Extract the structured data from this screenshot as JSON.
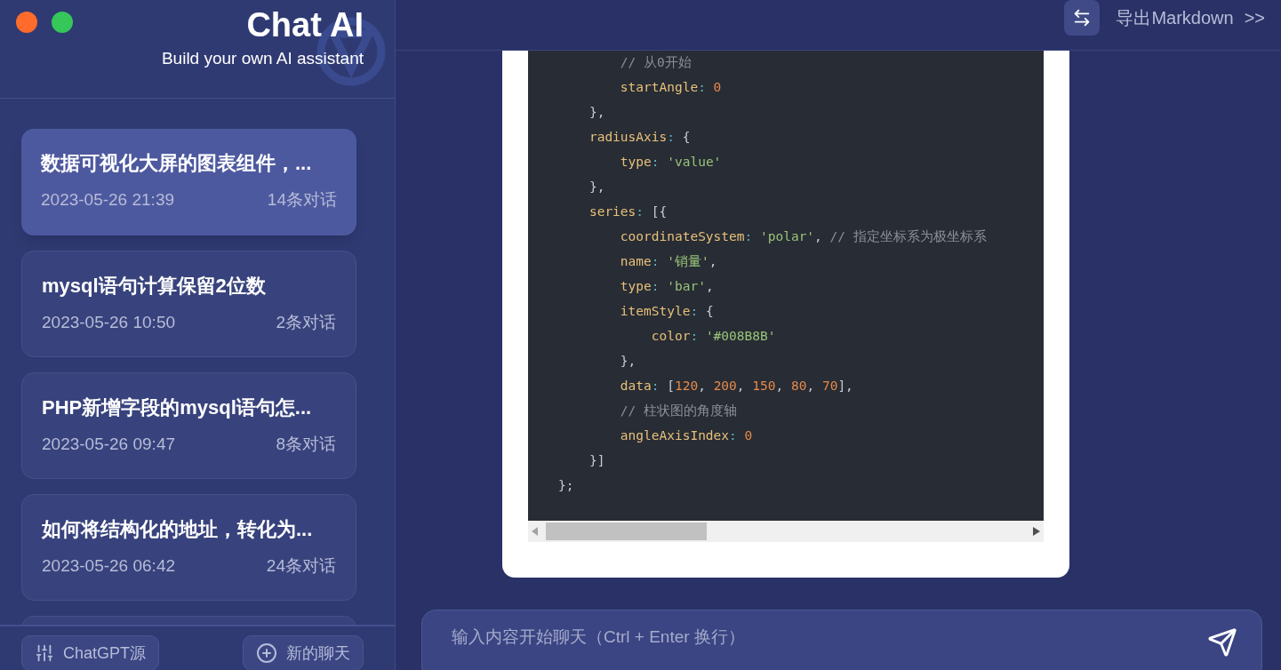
{
  "brand": {
    "title": "Chat AI",
    "subtitle": "Build your own AI assistant"
  },
  "conversations": [
    {
      "title": "数据可视化大屏的图表组件，...",
      "time": "2023-05-26 21:39",
      "count": "14条对话",
      "selected": true
    },
    {
      "title": "mysql语句计算保留2位数",
      "time": "2023-05-26 10:50",
      "count": "2条对话",
      "selected": false
    },
    {
      "title": "PHP新增字段的mysql语句怎...",
      "time": "2023-05-26 09:47",
      "count": "8条对话",
      "selected": false
    },
    {
      "title": "如何将结构化的地址，转化为...",
      "time": "2023-05-26 06:42",
      "count": "24条对话",
      "selected": false
    }
  ],
  "sidebar_buttons": [
    {
      "kind": "source",
      "label": "ChatGPT源"
    },
    {
      "kind": "new",
      "label": "新的聊天"
    }
  ],
  "header": {
    "export_label": "导出Markdown",
    "chevron": ">>"
  },
  "code_lines": [
    [
      {
        "kind": "comment",
        "text": "        // 从0开始"
      }
    ],
    [
      {
        "kind": "key",
        "text": "        startAngle"
      },
      {
        "kind": "punct",
        "text": ": "
      },
      {
        "kind": "number",
        "text": "0"
      }
    ],
    [
      {
        "kind": "plain",
        "text": "    },"
      }
    ],
    [
      {
        "kind": "key",
        "text": "    radiusAxis"
      },
      {
        "kind": "punct",
        "text": ": "
      },
      {
        "kind": "plain",
        "text": "{"
      }
    ],
    [
      {
        "kind": "key",
        "text": "        type"
      },
      {
        "kind": "punct",
        "text": ": "
      },
      {
        "kind": "string",
        "text": "'value'"
      }
    ],
    [
      {
        "kind": "plain",
        "text": "    },"
      }
    ],
    [
      {
        "kind": "key",
        "text": "    series"
      },
      {
        "kind": "punct",
        "text": ": "
      },
      {
        "kind": "plain",
        "text": "[{"
      }
    ],
    [
      {
        "kind": "key",
        "text": "        coordinateSystem"
      },
      {
        "kind": "punct",
        "text": ": "
      },
      {
        "kind": "string",
        "text": "'polar'"
      },
      {
        "kind": "plain",
        "text": ", "
      },
      {
        "kind": "comment",
        "text": "// 指定坐标系为极坐标系"
      }
    ],
    [
      {
        "kind": "key",
        "text": "        name"
      },
      {
        "kind": "punct",
        "text": ": "
      },
      {
        "kind": "string",
        "text": "'销量'"
      },
      {
        "kind": "plain",
        "text": ","
      }
    ],
    [
      {
        "kind": "key",
        "text": "        type"
      },
      {
        "kind": "punct",
        "text": ": "
      },
      {
        "kind": "string",
        "text": "'bar'"
      },
      {
        "kind": "plain",
        "text": ","
      }
    ],
    [
      {
        "kind": "key",
        "text": "        itemStyle"
      },
      {
        "kind": "punct",
        "text": ": "
      },
      {
        "kind": "plain",
        "text": "{"
      }
    ],
    [
      {
        "kind": "key",
        "text": "            color"
      },
      {
        "kind": "punct",
        "text": ": "
      },
      {
        "kind": "string",
        "text": "'#008B8B'"
      }
    ],
    [
      {
        "kind": "plain",
        "text": "        },"
      }
    ],
    [
      {
        "kind": "key",
        "text": "        data"
      },
      {
        "kind": "punct",
        "text": ": "
      },
      {
        "kind": "plain",
        "text": "["
      },
      {
        "kind": "number",
        "text": "120"
      },
      {
        "kind": "plain",
        "text": ", "
      },
      {
        "kind": "number",
        "text": "200"
      },
      {
        "kind": "plain",
        "text": ", "
      },
      {
        "kind": "number",
        "text": "150"
      },
      {
        "kind": "plain",
        "text": ", "
      },
      {
        "kind": "number",
        "text": "80"
      },
      {
        "kind": "plain",
        "text": ", "
      },
      {
        "kind": "number",
        "text": "70"
      },
      {
        "kind": "plain",
        "text": "],"
      }
    ],
    [
      {
        "kind": "comment",
        "text": "        // 柱状图的角度轴"
      }
    ],
    [
      {
        "kind": "key",
        "text": "        angleAxisIndex"
      },
      {
        "kind": "punct",
        "text": ": "
      },
      {
        "kind": "number",
        "text": "0"
      }
    ],
    [
      {
        "kind": "plain",
        "text": "    }]"
      }
    ],
    [
      {
        "kind": "plain",
        "text": "};"
      }
    ]
  ],
  "input": {
    "placeholder": "输入内容开始聊天（Ctrl + Enter 换行）"
  }
}
